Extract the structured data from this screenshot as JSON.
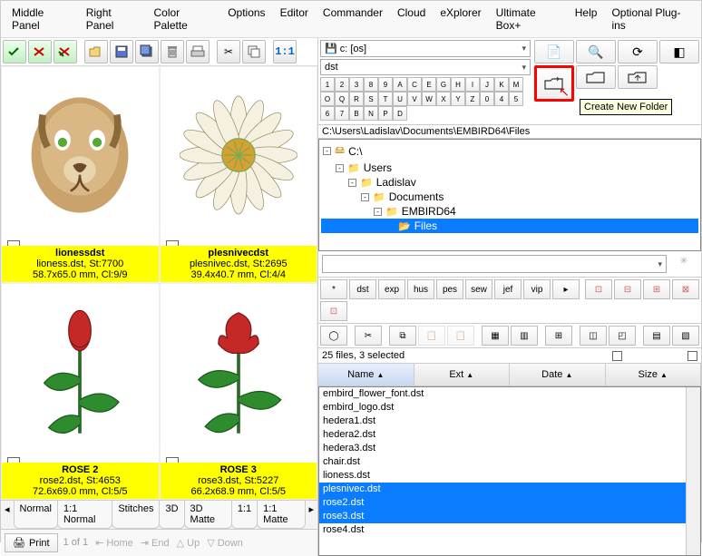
{
  "menu": [
    "Middle Panel",
    "Right Panel",
    "Color Palette",
    "Options",
    "Editor",
    "Commander",
    "Cloud",
    "eXplorer",
    "Ultimate Box+",
    "Help",
    "Optional Plug-ins"
  ],
  "left_toolbar": {
    "icon_count": 12
  },
  "thumbs": [
    {
      "title": "lionessdst",
      "line2": "lioness.dst, St:7700",
      "line3": "58.7x65.0 mm, Cl:9/9"
    },
    {
      "title": "plesnivecdst",
      "line2": "plesnivec.dst, St:2695",
      "line3": "39.4x40.7 mm, Cl:4/4"
    },
    {
      "title": "ROSE 2",
      "line2": "rose2.dst, St:4653",
      "line3": "72.6x69.0 mm, Cl:5/5"
    },
    {
      "title": "ROSE 3",
      "line2": "rose3.dst, St:5227",
      "line3": "66.2x68.9 mm, Cl:5/5"
    }
  ],
  "view_tabs": [
    "Normal",
    "1:1 Normal",
    "Stitches",
    "3D",
    "3D Matte",
    "1:1",
    "1:1 Matte"
  ],
  "footer": {
    "print": "Print",
    "pages": "1 of 1",
    "home": "Home",
    "end": "End",
    "up": "Up",
    "down": "Down"
  },
  "right": {
    "drive": "c: [os]",
    "ext_filter": "dst",
    "letters_row1": [
      "1",
      "2",
      "3",
      "8",
      "9",
      "A",
      "C",
      "E",
      "G",
      "H",
      "I",
      "J",
      "K",
      "M",
      "O",
      "Q",
      "R"
    ],
    "letters_row2": [
      "S",
      "T",
      "U",
      "V",
      "W",
      "X",
      "Y",
      "Z",
      "0",
      "4",
      "5",
      "6",
      "7",
      "B",
      "N",
      "P",
      "D"
    ],
    "path": "C:\\Users\\Ladislav\\Documents\\EMBIRD64\\Files",
    "tree": [
      {
        "indent": 0,
        "label": "C:\\",
        "plus": "-",
        "icon": "drive"
      },
      {
        "indent": 1,
        "label": "Users",
        "plus": "-",
        "icon": "folder"
      },
      {
        "indent": 2,
        "label": "Ladislav",
        "plus": "-",
        "icon": "folder"
      },
      {
        "indent": 3,
        "label": "Documents",
        "plus": "-",
        "icon": "folder"
      },
      {
        "indent": 4,
        "label": "EMBIRD64",
        "plus": "-",
        "icon": "folder"
      },
      {
        "indent": 5,
        "label": "Files",
        "plus": "",
        "icon": "open",
        "sel": true
      }
    ],
    "formats": [
      "*",
      "dst",
      "exp",
      "hus",
      "pes",
      "sew",
      "jef",
      "vip"
    ],
    "status": "25 files, 3 selected",
    "headers": [
      {
        "label": "Name",
        "sort": "▲",
        "active": true
      },
      {
        "label": "Ext",
        "sort": "▲"
      },
      {
        "label": "Date",
        "sort": "▲"
      },
      {
        "label": "Size",
        "sort": "▲"
      }
    ],
    "files": [
      {
        "name": "embird_flower_font.dst"
      },
      {
        "name": "embird_logo.dst"
      },
      {
        "name": "hedera1.dst"
      },
      {
        "name": "hedera2.dst"
      },
      {
        "name": "hedera3.dst"
      },
      {
        "name": "chair.dst"
      },
      {
        "name": "lioness.dst"
      },
      {
        "name": "plesnivec.dst",
        "sel": true
      },
      {
        "name": "rose2.dst",
        "sel": true
      },
      {
        "name": "rose3.dst",
        "sel": true
      },
      {
        "name": "rose4.dst"
      }
    ]
  },
  "tooltip": "Create New Folder"
}
